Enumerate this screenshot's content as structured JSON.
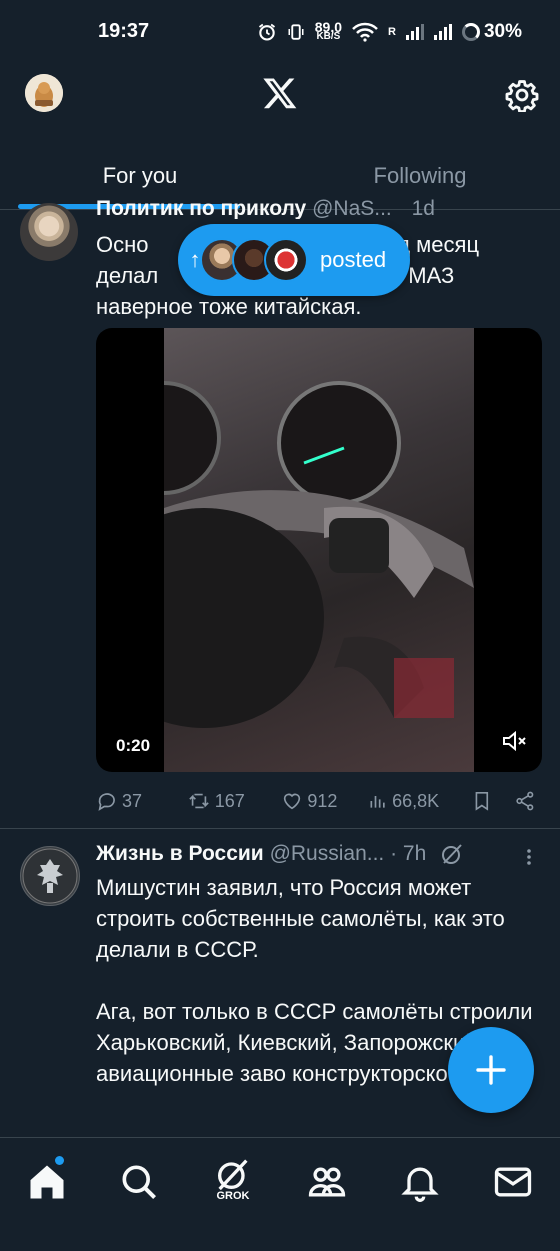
{
  "status_bar": {
    "time": "19:37",
    "speed_value": "89,0",
    "speed_unit": "KB/S",
    "roaming": "R",
    "battery": "30%"
  },
  "header": {
    "logo": "x-logo",
    "settings_icon": "gear-icon"
  },
  "tabs": [
    {
      "label": "For you",
      "active": true
    },
    {
      "label": "Following",
      "active": false
    }
  ],
  "posted_pill": {
    "label": "posted"
  },
  "tweet1": {
    "display_name": "Политик по приколу",
    "handle": "@NaS...",
    "time": "1d",
    "text_lines": [
      "Осно",
      "Завод месяц",
      "делал",
      "МАЗ",
      "наверное тоже китайская."
    ],
    "video_duration": "0:20",
    "replies": "37",
    "reposts": "167",
    "likes": "912",
    "views": "66,8K"
  },
  "tweet2": {
    "display_name": "Жизнь в России",
    "handle": "@Russian...",
    "time": "· 7h",
    "text": "Мишустин заявил, что Россия может строить собственные самолёты, как это делали в СССР.",
    "text2": "Ага, вот только в СССР самолёты строили Харьковский, Киевский, Запорожский авиационные заво конструкторское бюро им. Антонов"
  },
  "bottom_nav": {
    "grok_label": "GROK"
  },
  "colors": {
    "background": "#15202b",
    "accent": "#1d9bf0",
    "secondary_text": "#8b98a5"
  }
}
